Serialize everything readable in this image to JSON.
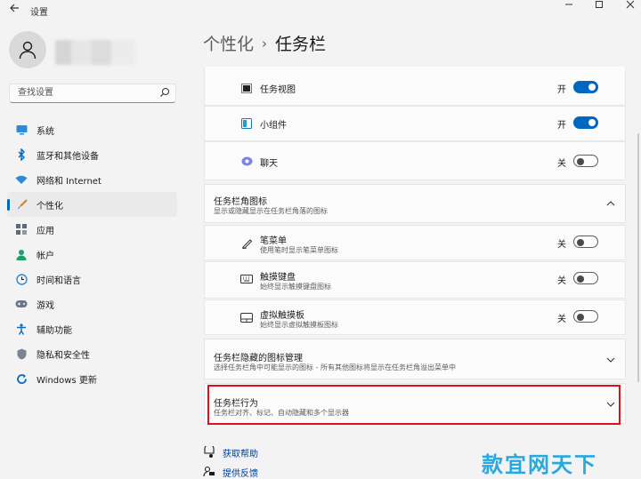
{
  "window": {
    "title": "设置"
  },
  "user": {
    "name_hidden": true
  },
  "search": {
    "placeholder": "查找设置"
  },
  "sidebar": {
    "items": [
      {
        "label": "系统",
        "icon": "monitor-icon",
        "active": false
      },
      {
        "label": "蓝牙和其他设备",
        "icon": "bluetooth-icon",
        "active": false
      },
      {
        "label": "网络和 Internet",
        "icon": "wifi-icon",
        "active": false
      },
      {
        "label": "个性化",
        "icon": "brush-icon",
        "active": true
      },
      {
        "label": "应用",
        "icon": "apps-icon",
        "active": false
      },
      {
        "label": "帐户",
        "icon": "person-icon",
        "active": false
      },
      {
        "label": "时间和语言",
        "icon": "globe-clock-icon",
        "active": false
      },
      {
        "label": "游戏",
        "icon": "gamepad-icon",
        "active": false
      },
      {
        "label": "辅助功能",
        "icon": "accessibility-icon",
        "active": false
      },
      {
        "label": "隐私和安全性",
        "icon": "shield-icon",
        "active": false
      },
      {
        "label": "Windows 更新",
        "icon": "update-icon",
        "active": false
      }
    ]
  },
  "breadcrumb": {
    "parent": "个性化",
    "separator": "›",
    "current": "任务栏"
  },
  "taskbar_items": [
    {
      "label": "任务视图",
      "state": "开",
      "on": true,
      "icon": "task-view-icon"
    },
    {
      "label": "小组件",
      "state": "开",
      "on": true,
      "icon": "widgets-icon"
    },
    {
      "label": "聊天",
      "state": "关",
      "on": false,
      "icon": "chat-icon"
    }
  ],
  "corner_icons": {
    "title": "任务栏角图标",
    "subtitle": "显示或隐藏显示在任务栏角落的图标",
    "items": [
      {
        "label": "笔菜单",
        "sub": "使用笔时显示笔菜单图标",
        "state": "关",
        "on": false,
        "icon": "pen-icon"
      },
      {
        "label": "触摸键盘",
        "sub": "始终显示触摸键盘图标",
        "state": "关",
        "on": false,
        "icon": "keyboard-icon"
      },
      {
        "label": "虚拟触摸板",
        "sub": "始终显示虚拟触摸板图标",
        "state": "关",
        "on": false,
        "icon": "touchpad-icon"
      }
    ]
  },
  "overflow": {
    "title": "任务栏隐藏的图标管理",
    "subtitle": "选择任务栏角中可能显示的图标 - 所有其他图标将显示在任务栏角溢出菜单中"
  },
  "behaviors": {
    "title": "任务栏行为",
    "subtitle": "任务栏对齐、标记、自动隐藏和多个显示器"
  },
  "links": {
    "help": "获取帮助",
    "feedback": "提供反馈"
  },
  "watermark": {
    "text": "款宜网天下"
  },
  "colors": {
    "accent": "#0067c0",
    "highlight": "#d7141c"
  }
}
